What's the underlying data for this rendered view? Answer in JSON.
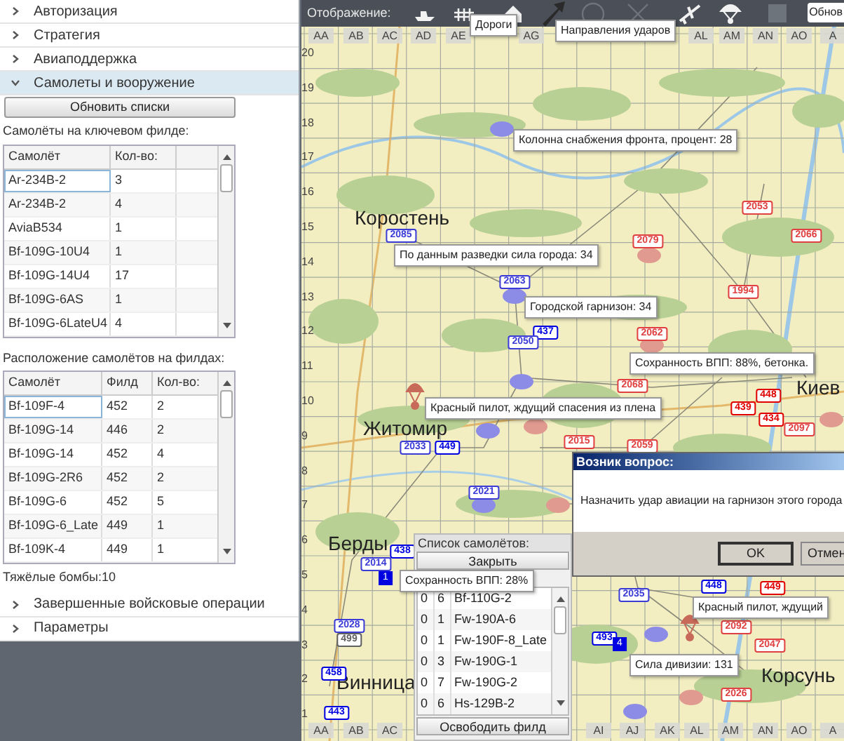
{
  "sidebar": {
    "accordion": [
      {
        "label": "Авторизация",
        "expanded": false
      },
      {
        "label": "Стратегия",
        "expanded": false
      },
      {
        "label": "Авиаподдержка",
        "expanded": false
      },
      {
        "label": "Самолеты и вооружение",
        "expanded": true
      },
      {
        "label": "Завершенные войсковые операции",
        "expanded": false
      },
      {
        "label": "Параметры",
        "expanded": false
      }
    ],
    "refresh_button": "Обновить списки",
    "key_field_label": "Самолёты на ключевом филде:",
    "key_field_table": {
      "columns": [
        "Самолёт",
        "Кол-во:"
      ],
      "rows": [
        {
          "cells": [
            "Ar-234B-2",
            "3"
          ],
          "selected": true
        },
        {
          "cells": [
            "Ar-234B-2",
            "4"
          ],
          "selected": false
        },
        {
          "cells": [
            "AviaB534",
            "1"
          ],
          "selected": false
        },
        {
          "cells": [
            "Bf-109G-10U4",
            "1"
          ],
          "selected": false
        },
        {
          "cells": [
            "Bf-109G-14U4",
            "17"
          ],
          "selected": false
        },
        {
          "cells": [
            "Bf-109G-6AS",
            "1"
          ],
          "selected": false
        },
        {
          "cells": [
            "Bf-109G-6LateU4",
            "4"
          ],
          "selected": false
        }
      ]
    },
    "fields_label": "Расположение самолётов на филдах:",
    "fields_table": {
      "columns": [
        "Самолёт",
        "Филд",
        "Кол-во:"
      ],
      "rows": [
        {
          "cells": [
            "Bf-109F-4",
            "452",
            "2"
          ],
          "selected": true
        },
        {
          "cells": [
            "Bf-109G-14",
            "446",
            "2"
          ],
          "selected": false
        },
        {
          "cells": [
            "Bf-109G-14",
            "452",
            "4"
          ],
          "selected": false
        },
        {
          "cells": [
            "Bf-109G-2R6",
            "452",
            "2"
          ],
          "selected": false
        },
        {
          "cells": [
            "Bf-109G-6",
            "452",
            "5"
          ],
          "selected": false
        },
        {
          "cells": [
            "Bf-109G-6_Late",
            "449",
            "1"
          ],
          "selected": false
        },
        {
          "cells": [
            "Bf-109K-4",
            "449",
            "1"
          ],
          "selected": false
        }
      ]
    },
    "heavy_bombs": "Тяжёлые бомбы:10"
  },
  "toolbar": {
    "label": "Отображение:",
    "refresh_button": "Обнов",
    "tooltips": [
      "Дороги",
      "Направления ударов"
    ]
  },
  "map": {
    "columns_top": [
      "AA",
      "AB",
      "AC",
      "AD",
      "AE",
      "AG",
      "AL",
      "AM",
      "AN",
      "AO",
      "A"
    ],
    "columns_bottom": [
      "AA",
      "AB",
      "AC",
      "AI",
      "AJ",
      "AK",
      "AL",
      "AM",
      "AN",
      "AO",
      "A"
    ],
    "rows": [
      "20",
      "19",
      "18",
      "17",
      "16",
      "15",
      "14",
      "13",
      "12",
      "11",
      "10",
      "9",
      "8",
      "7",
      "6",
      "5",
      "4",
      "3",
      "2",
      "1"
    ],
    "cities": [
      {
        "name": "Коростень"
      },
      {
        "name": "Житомир"
      },
      {
        "name": "Киев"
      },
      {
        "name": "Берды"
      },
      {
        "name": "Винница"
      },
      {
        "name": "Корсунь"
      }
    ],
    "markers": [
      {
        "kind": "unit",
        "color": "#8c8ce6"
      },
      {
        "kind": "tag",
        "color": "#3b3bd6",
        "label": "2085"
      },
      {
        "kind": "unit",
        "color": "#e09a90"
      },
      {
        "kind": "tag",
        "color": "#e04040",
        "label": "2079"
      },
      {
        "kind": "tag",
        "color": "#e04040",
        "label": "2053"
      },
      {
        "kind": "tag",
        "color": "#e04040",
        "label": "2066"
      },
      {
        "kind": "tag",
        "color": "#e04040",
        "label": "1994"
      },
      {
        "kind": "unit",
        "color": "#8c8ce6"
      },
      {
        "kind": "tag",
        "color": "#3b3bd6",
        "label": "2063"
      },
      {
        "kind": "tag",
        "color": "#0000e0",
        "label": "437"
      },
      {
        "kind": "tag",
        "color": "#3b3bd6",
        "label": "2050"
      },
      {
        "kind": "unit",
        "color": "#e09a90"
      },
      {
        "kind": "tag",
        "color": "#e04040",
        "label": "2062"
      },
      {
        "kind": "unit",
        "color": "#8c8ce6"
      },
      {
        "kind": "tag",
        "color": "#e04040",
        "label": "2068"
      },
      {
        "kind": "tag",
        "color": "#e00000",
        "label": "448"
      },
      {
        "kind": "tag",
        "color": "#e00000",
        "label": "439"
      },
      {
        "kind": "tag",
        "color": "#e00000",
        "label": "434"
      },
      {
        "kind": "tag",
        "color": "#e04040",
        "label": "2097"
      },
      {
        "kind": "unit",
        "color": "#e09a90"
      },
      {
        "kind": "pilot",
        "color": "#c86a5a"
      },
      {
        "kind": "unit",
        "color": "#8c8ce6"
      },
      {
        "kind": "unit",
        "color": "#e09a90"
      },
      {
        "kind": "tag",
        "color": "#3b3bd6",
        "label": "2033"
      },
      {
        "kind": "tag",
        "color": "#0000e0",
        "label": "449"
      },
      {
        "kind": "tag",
        "color": "#e04040",
        "label": "2015"
      },
      {
        "kind": "tag",
        "color": "#e04040",
        "label": "2059"
      },
      {
        "kind": "unit",
        "color": "#8c8ce6"
      },
      {
        "kind": "tag",
        "color": "#3b3bd6",
        "label": "2021"
      },
      {
        "kind": "unit",
        "color": "#e09a90"
      },
      {
        "kind": "tag",
        "color": "#0000e0",
        "label": "438"
      },
      {
        "kind": "tag",
        "color": "#3b3bd6",
        "label": "2014"
      },
      {
        "kind": "badge",
        "color": "#0000e0",
        "label": "1"
      },
      {
        "kind": "tag",
        "color": "#3b3bd6",
        "label": "2028"
      },
      {
        "kind": "tag",
        "color": "#606060",
        "label": "499"
      },
      {
        "kind": "tag",
        "color": "#0000e0",
        "label": "458"
      },
      {
        "kind": "tag",
        "color": "#0000e0",
        "label": "443"
      },
      {
        "kind": "tag",
        "color": "#0000e0",
        "label": "448"
      },
      {
        "kind": "tag",
        "color": "#3b3bd6",
        "label": "2035"
      },
      {
        "kind": "tag",
        "color": "#0000e0",
        "label": "493"
      },
      {
        "kind": "badge",
        "color": "#0000e0",
        "label": "4"
      },
      {
        "kind": "unit",
        "color": "#8c8ce6"
      },
      {
        "kind": "pilot",
        "color": "#c86a5a"
      },
      {
        "kind": "tag",
        "color": "#e04040",
        "label": "2092"
      },
      {
        "kind": "tag",
        "color": "#e04040",
        "label": "2047"
      },
      {
        "kind": "unit",
        "color": "#e09a90"
      },
      {
        "kind": "tag",
        "color": "#e04040",
        "label": "2026"
      },
      {
        "kind": "unit",
        "color": "#8c8ce6"
      },
      {
        "kind": "tag",
        "color": "#e00000",
        "label": "449"
      }
    ],
    "tooltips": [
      "Колонна снабжения фронта, процент: 28",
      "По данным разведки сила города: 34",
      "Городской гарнизон: 34",
      "Сохранность ВПП: 88%, бетонка.",
      "Красный пилот, ждущий спасения из плена",
      "Сохранность ВПП: 28%",
      "Красный пилот, ждущий",
      "Сила дивизии: 131"
    ]
  },
  "plane_list": {
    "title": "Список самолётов:",
    "close_button": "Закрыть",
    "rows": [
      [
        "0",
        "6",
        "Bf-110G-2"
      ],
      [
        "0",
        "1",
        "Fw-190A-6"
      ],
      [
        "0",
        "1",
        "Fw-190F-8_Late"
      ],
      [
        "0",
        "3",
        "Fw-190G-1"
      ],
      [
        "0",
        "7",
        "Fw-190G-2"
      ],
      [
        "0",
        "6",
        "Hs-129B-2"
      ]
    ],
    "release_button": "Освободить филд"
  },
  "dialog": {
    "title": "Возник вопрос:",
    "message": "Назначить удар авиации на гарнизон этого города",
    "buttons": [
      "OK",
      "Отмен"
    ]
  }
}
